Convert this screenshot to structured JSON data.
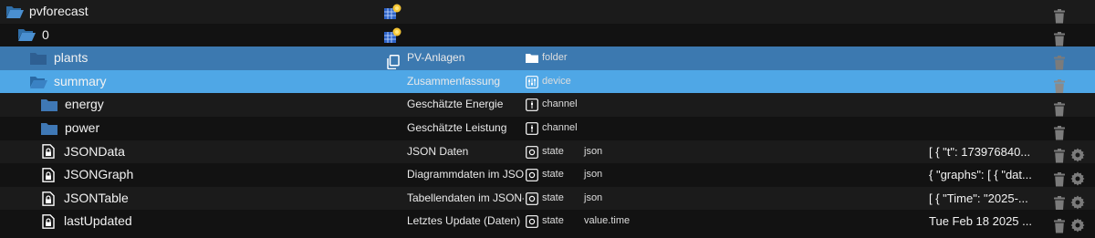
{
  "rows": [
    {
      "name": "pvforecast",
      "desc": "",
      "type": "",
      "role": "",
      "value": ""
    },
    {
      "name": "0",
      "desc": "",
      "type": "",
      "role": "",
      "value": ""
    },
    {
      "name": "plants",
      "desc": "PV-Anlagen",
      "type": "folder",
      "role": "",
      "value": ""
    },
    {
      "name": "summary",
      "desc": "Zusammenfassung",
      "type": "device",
      "role": "",
      "value": ""
    },
    {
      "name": "energy",
      "desc": "Geschätzte Energie",
      "type": "channel",
      "role": "",
      "value": ""
    },
    {
      "name": "power",
      "desc": "Geschätzte Leistung",
      "type": "channel",
      "role": "",
      "value": ""
    },
    {
      "name": "JSONData",
      "desc": "JSON Daten",
      "type": "state",
      "role": "json",
      "value": "[ { \"t\": 173976840..."
    },
    {
      "name": "JSONGraph",
      "desc": "Diagrammdaten im JSO...",
      "type": "state",
      "role": "json",
      "value": "{ \"graphs\": [ { \"dat..."
    },
    {
      "name": "JSONTable",
      "desc": "Tabellendaten im JSON-...",
      "type": "state",
      "role": "json",
      "value": "[ { \"Time\": \"2025-..."
    },
    {
      "name": "lastUpdated",
      "desc": "Letztes Update (Daten)",
      "type": "state",
      "role": "value.time",
      "value": "Tue Feb 18 2025 ..."
    }
  ],
  "colors": {
    "selected_dark": "#3c79b0",
    "selected_light": "#4fa7e6",
    "folder": "#3f78b5"
  },
  "icons": [
    "folder-open-icon",
    "folder-icon",
    "file-lock-icon",
    "solar-panel-icon",
    "copy-icon",
    "trash-icon",
    "gear-icon",
    "device-icon",
    "channel-icon",
    "state-icon"
  ]
}
